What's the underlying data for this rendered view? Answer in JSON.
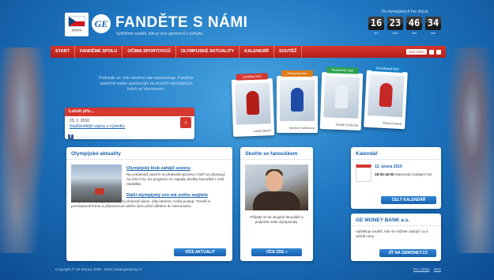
{
  "header": {
    "title": "FANDĚTE S NÁMI",
    "subtitle": "Vyhlížíme soutěž, kde je více sportovců v pohybu",
    "countdown": {
      "label": "Do olympijských her zbývá",
      "days": "16",
      "hours": "23",
      "minutes": "46",
      "seconds": "34",
      "days_unit": "dní",
      "hours_unit": "hod",
      "minutes_unit": "min",
      "seconds_unit": "sek"
    }
  },
  "nav": {
    "items": [
      "START",
      "FANDĚME SPOLU",
      "OČIMA SPORTOVCŮ",
      "OLYMPIJSKÉ AKTUALITY",
      "KALENDÁŘ",
      "SOUTĚŽ"
    ],
    "pill": "RSS FEED"
  },
  "hero": {
    "text": "Podívejte se, kdo všechno nás reprezentuje. Fandíme společně našim sportovcům na zimních olympijských hrách ve Vancouveru.",
    "todo": {
      "header": "Letoší přiz...",
      "date": "23. 1. 2010",
      "link": "Nejdůležitější zápisy a výsledky",
      "arrow": "›"
    },
    "facebook": "Najdete nás také na Facebooku",
    "cards": [
      {
        "tag": "Lyžařský klub",
        "name": "Lukáš Bauer",
        "color": "#d6372f",
        "suit": "#b51e18"
      },
      {
        "tag": "Hokejový klub",
        "name": "Martina Sáblíková",
        "color": "#e07b1a",
        "suit": "#1f4aa8"
      },
      {
        "tag": "Skokanský klub",
        "name": "Tomáš Svoboda",
        "color": "#2aa34a",
        "suit": "#e8eef5"
      },
      {
        "tag": "Snowboard klub",
        "name": "Petra Kvitová",
        "color": "#1a82c8",
        "suit": "#c62828"
      }
    ]
  },
  "news": {
    "title": "Olympijské aktuality",
    "a1_title": "Olympijský klub zahájil sezónu",
    "a1_body": "Na uvedených akcích se předvedli sportovci, kteří se připravují na zimní hry. Do programu se zapojily desítky fanoušků z celé republiky.",
    "a2_title": "Další olympijský sen má svého majitele",
    "a2_body": "Druhý den na olympijských akcích předvedl výkon, díky kterému získal postup. Trenéři si pochvalovali formu a připravenost celého týmu před odletem do Vancouveru.",
    "button": "VÍCE AKTUALIT"
  },
  "sport": {
    "title": "Skočte se fanouškem",
    "text": "Přidejte se ke skupině fanoušků a podpořte naše olympioniky.",
    "button": "VÍCE ZDE »"
  },
  "calendar": {
    "title": "Kalendář",
    "date": "12. února 2010",
    "time": "18:00-19:00",
    "body": "Slavnostní zahájení her",
    "button": "CELÝ KALENDÁŘ"
  },
  "ge": {
    "title": "GE MONEY BANK a.s.",
    "body": "Vyhlašuje soutěž, kde se můžete zapojit i vy a vyhrát ceny.",
    "button": "JÍT NA GEMONEY.CZ"
  },
  "footer": {
    "copyright": "Copyright © GE Money 2009 - 2010  |  www.gemoney.cz",
    "link1": "Pro média",
    "link2": "RSS"
  }
}
